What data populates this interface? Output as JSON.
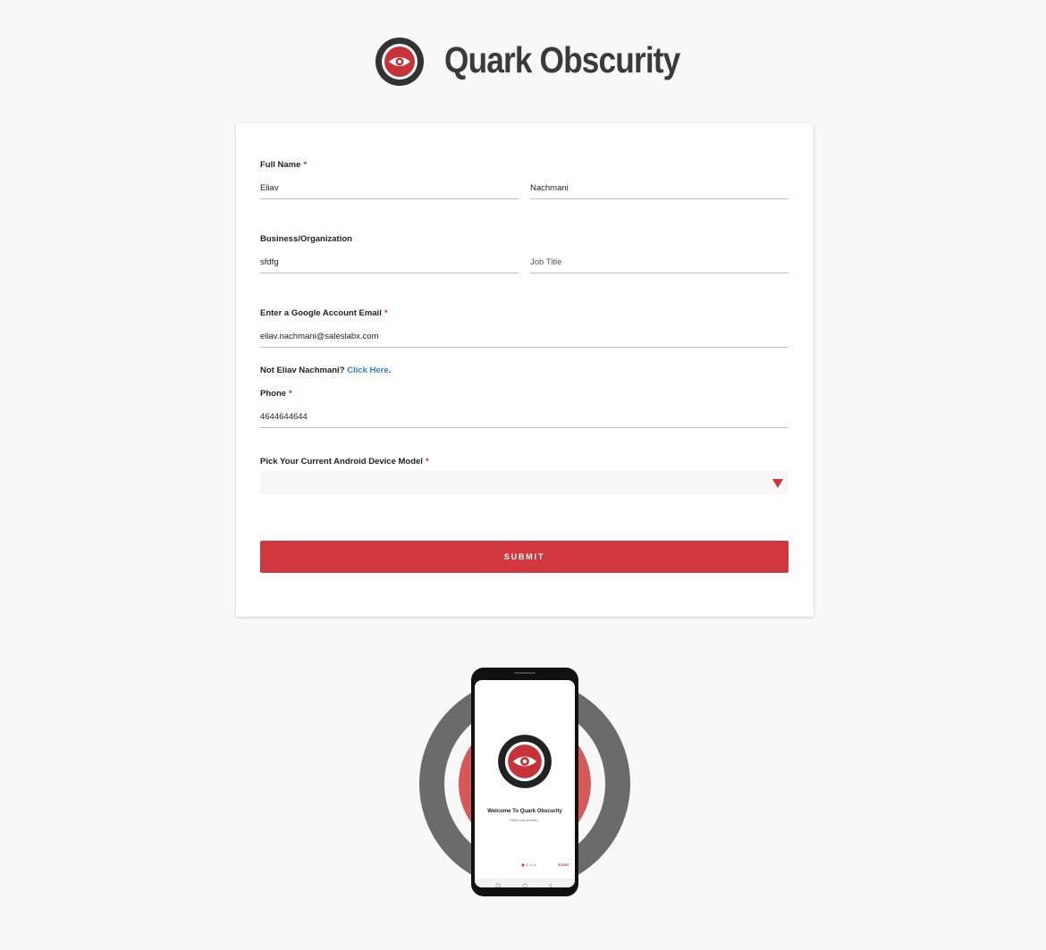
{
  "header": {
    "brand_name": "Quark Obscurity",
    "logo_icon": "eye-icon"
  },
  "form": {
    "full_name": {
      "label": "Full Name",
      "required_mark": "*",
      "first_value": "Eliav",
      "last_value": "Nachmani"
    },
    "business": {
      "label": "Business/Organization",
      "org_value": "sfdfg",
      "job_title_placeholder": "Job Title"
    },
    "email": {
      "label": "Enter a Google Account Email",
      "required_mark": "*",
      "value": "eliav.nachmani@saleslabx.com"
    },
    "not_you": {
      "prefix": "Not Eliav Nachmani?",
      "link_text": "Click Here",
      "suffix": "."
    },
    "phone": {
      "label": "Phone",
      "required_mark": "*",
      "value": "4644644644"
    },
    "device": {
      "label": "Pick Your Current Android Device Model",
      "required_mark": "*",
      "selected": ""
    },
    "submit_label": "SUBMIT"
  },
  "phone_mockup": {
    "welcome_title": "Welcome To Quark Obscurity",
    "welcome_sub": "Here's how it works...",
    "start_label": "START"
  },
  "colors": {
    "accent": "#d0373f",
    "link": "#2f7dc4",
    "background": "#f8f8f8",
    "ring_gray": "#6b6b6b"
  }
}
